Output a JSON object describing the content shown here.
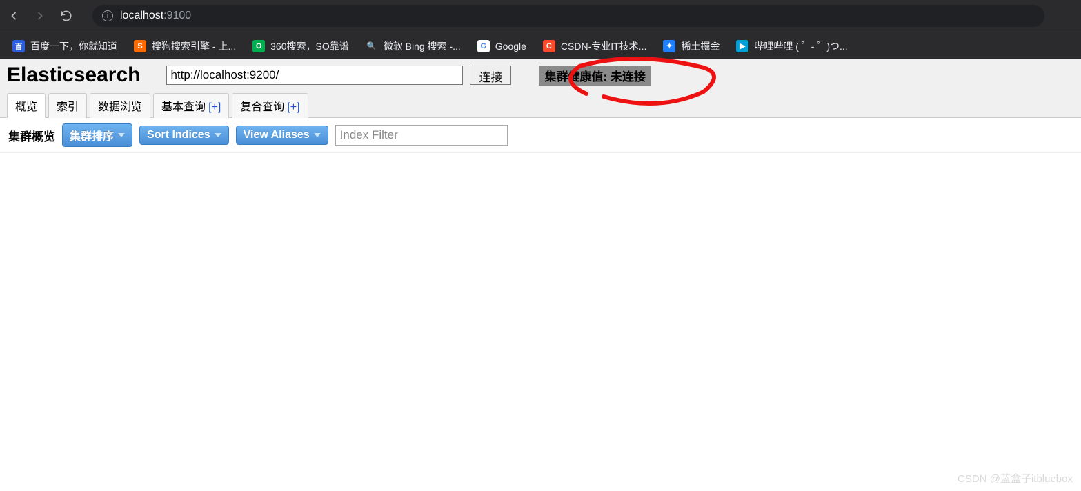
{
  "browser": {
    "url_host": "localhost",
    "url_port": ":9100"
  },
  "bookmarks": [
    {
      "label": "百度一下，你就知道",
      "bg": "#2a5fdd",
      "initial": "百"
    },
    {
      "label": "搜狗搜索引擎 - 上...",
      "bg": "#ff6a00",
      "initial": "S"
    },
    {
      "label": "360搜索，SO靠谱",
      "bg": "#00b050",
      "initial": "O"
    },
    {
      "label": "微软 Bing 搜索 -...",
      "bg": "#2b2b2e",
      "initial": "🔍"
    },
    {
      "label": "Google",
      "bg": "#ffffff",
      "initial": "G"
    },
    {
      "label": "CSDN-专业IT技术...",
      "bg": "#fc4a2a",
      "initial": "C"
    },
    {
      "label": "稀土掘金",
      "bg": "#1e80ff",
      "initial": "✦"
    },
    {
      "label": "哔哩哔哩 (  ゜-  ゜)つ...",
      "bg": "#00a1d6",
      "initial": "▶"
    }
  ],
  "header": {
    "title": "Elasticsearch",
    "url_value": "http://localhost:9200/",
    "connect_label": "连接",
    "health_label": "集群健康值: 未连接"
  },
  "tabs": [
    {
      "label": "概览",
      "plus": false,
      "active": true
    },
    {
      "label": "索引",
      "plus": false,
      "active": false
    },
    {
      "label": "数据浏览",
      "plus": false,
      "active": false
    },
    {
      "label": "基本查询",
      "plus": true,
      "active": false
    },
    {
      "label": "复合查询",
      "plus": true,
      "active": false
    }
  ],
  "toolbar": {
    "label": "集群概览",
    "sort_cluster": "集群排序",
    "sort_indices": "Sort Indices",
    "view_aliases": "View Aliases",
    "index_filter_placeholder": "Index Filter"
  },
  "watermark": "CSDN @蓝盒子itbluebox"
}
